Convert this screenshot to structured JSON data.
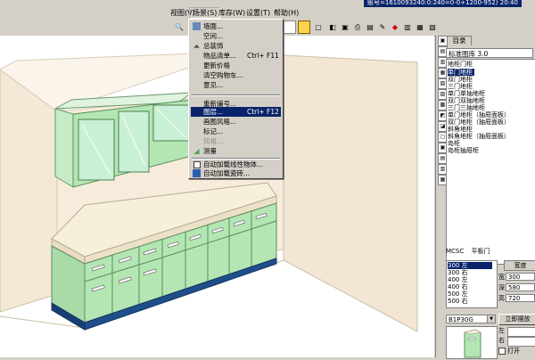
{
  "titlebar": {
    "text": "账号=1610093240:0:240=0-0+1200-952) 20:40"
  },
  "menubar": {
    "items": [
      {
        "label": "视图(V)"
      },
      {
        "label": "场景(S)"
      },
      {
        "label": "库存(W)"
      },
      {
        "label": "设置(T)"
      },
      {
        "label": "帮助(H)"
      }
    ]
  },
  "dropdown": {
    "items": [
      {
        "label": "墙面...",
        "shortcut": "",
        "icon": "wall-icon"
      },
      {
        "label": "空间...",
        "shortcut": "",
        "icon": ""
      },
      {
        "label": "总装饰",
        "shortcut": "",
        "icon": "decoration-icon"
      },
      {
        "label": "物品清单...",
        "shortcut": "Ctrl+ F11",
        "icon": ""
      },
      {
        "label": "更新价格",
        "shortcut": "",
        "icon": ""
      },
      {
        "label": "清空购物车...",
        "shortcut": "",
        "icon": ""
      },
      {
        "label": "意见...",
        "shortcut": "",
        "icon": ""
      },
      {
        "label": "重新编号...",
        "shortcut": "",
        "icon": ""
      },
      {
        "label": "图层...",
        "shortcut": "Ctrl+ F12",
        "icon": ""
      },
      {
        "label": "画图风格...",
        "shortcut": "",
        "icon": ""
      },
      {
        "label": "标记...",
        "shortcut": "",
        "icon": ""
      },
      {
        "label": "风格...",
        "shortcut": "",
        "icon": ""
      },
      {
        "label": "测量",
        "shortcut": "",
        "icon": "measure-icon"
      },
      {
        "label": "自动加载线性物体...",
        "shortcut": "",
        "icon": ""
      },
      {
        "label": "自动加载瓷砖...",
        "shortcut": "",
        "icon": "tile-icon"
      }
    ]
  },
  "right_panel": {
    "tab_label": "目录",
    "catalog": "标准图库 3.0",
    "tree": [
      "地柜门柜",
      "单门地柜",
      "双门地柜",
      "三门地柜",
      "单门单抽地柜",
      "双门双抽地柜",
      "三门三抽地柜",
      "单门地柜（抽屉面板）",
      "双门地柜（抽屉面板）",
      "斜角地柜",
      "斜角地柜（抽屉面板）",
      "岛柜",
      "岛柜抽屉柜"
    ],
    "mcsc_label": "MCSC",
    "mcsc_value": "平板门",
    "sizes": [
      "300 左",
      "300 右",
      "400 左",
      "400 右",
      "500 左",
      "500 右"
    ],
    "width_header": "宽度",
    "dims": [
      {
        "key": "宽",
        "value": "300"
      },
      {
        "key": "深",
        "value": "580"
      },
      {
        "key": "高",
        "value": "720"
      }
    ],
    "code": "B1P30G",
    "stand_button": "立即摆放",
    "left_label": "左",
    "right_label": "右",
    "open_label": "打开"
  },
  "colors": {
    "cabinet": "#b3e6b3",
    "countertop": "#f6efdc",
    "wall": "#f4e8d6",
    "plinth": "#1f4e8c",
    "selection": "#0a246a"
  }
}
